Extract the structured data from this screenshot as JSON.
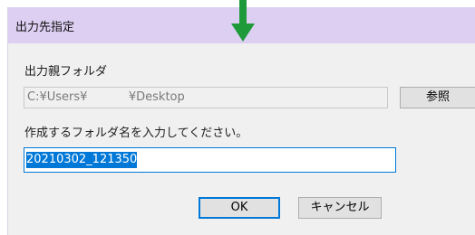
{
  "window": {
    "title": "出力先指定"
  },
  "output_parent_folder": {
    "label": "出力親フォルダ",
    "value": "C:¥Users¥           ¥Desktop"
  },
  "browse_button": {
    "label": "参照"
  },
  "folder_name": {
    "label": "作成するフォルダ名を入力してください。",
    "value": "20210302_121350"
  },
  "buttons": {
    "ok_label": "OK",
    "cancel_label": "キャンセル"
  },
  "colors": {
    "titlebar": "#dccff1",
    "arrow": "#1f9a3a",
    "selection": "#0078d7",
    "dialog_bg": "#f0f0f0"
  },
  "icons": {
    "pointer": "green-down-arrow-icon"
  }
}
